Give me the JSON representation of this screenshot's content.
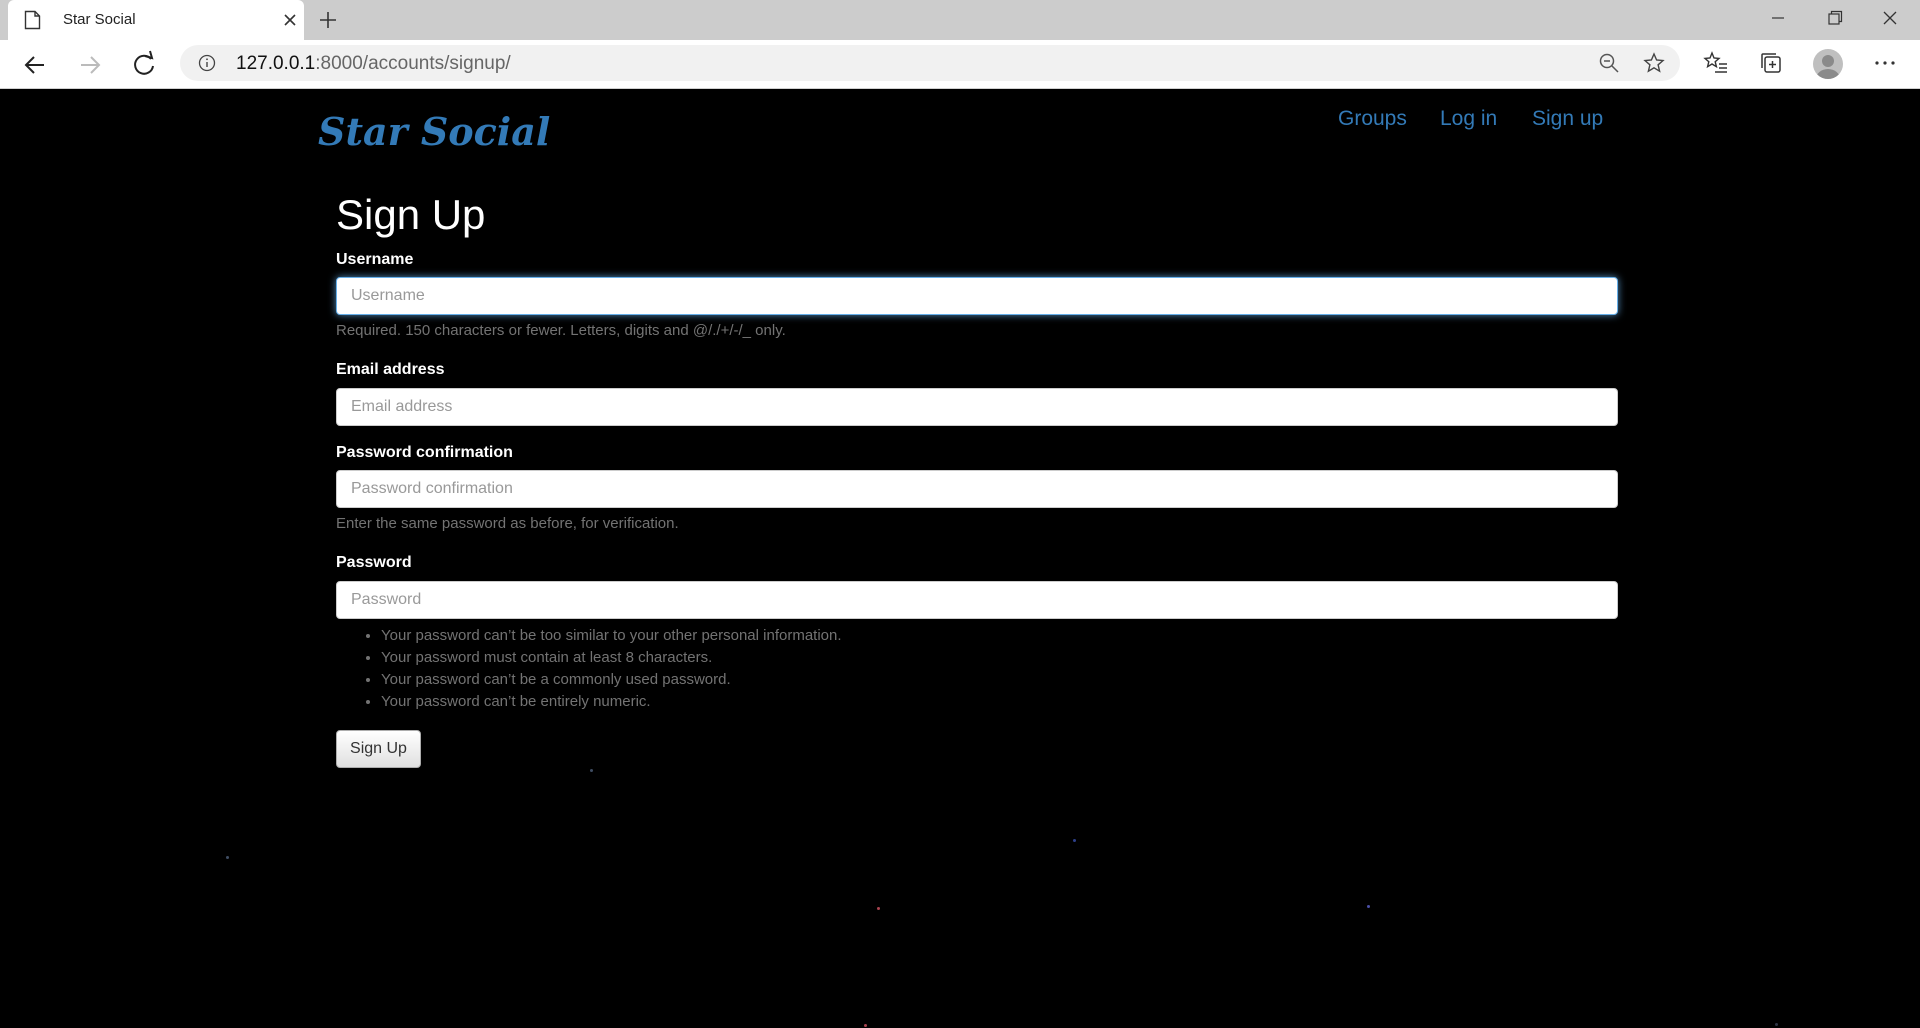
{
  "browser": {
    "tab_title": "Star Social",
    "url_host": "127.0.0.1",
    "url_path": ":8000/accounts/signup/"
  },
  "site": {
    "brand": "Star Social",
    "nav": {
      "groups": "Groups",
      "login": "Log in",
      "signup": "Sign up"
    },
    "accent_color": "#337ab7"
  },
  "form": {
    "heading": "Sign Up",
    "username": {
      "label": "Username",
      "placeholder": "Username",
      "value": "",
      "help": "Required. 150 characters or fewer. Letters, digits and @/./+/-/_ only."
    },
    "email": {
      "label": "Email address",
      "placeholder": "Email address",
      "value": ""
    },
    "password_confirmation": {
      "label": "Password confirmation",
      "placeholder": "Password confirmation",
      "value": "",
      "help": "Enter the same password as before, for verification."
    },
    "password": {
      "label": "Password",
      "placeholder": "Password",
      "value": "",
      "rules": [
        "Your password can’t be too similar to your other personal information.",
        "Your password must contain at least 8 characters.",
        "Your password can’t be a commonly used password.",
        "Your password can’t be entirely numeric."
      ]
    },
    "submit_label": "Sign Up"
  }
}
